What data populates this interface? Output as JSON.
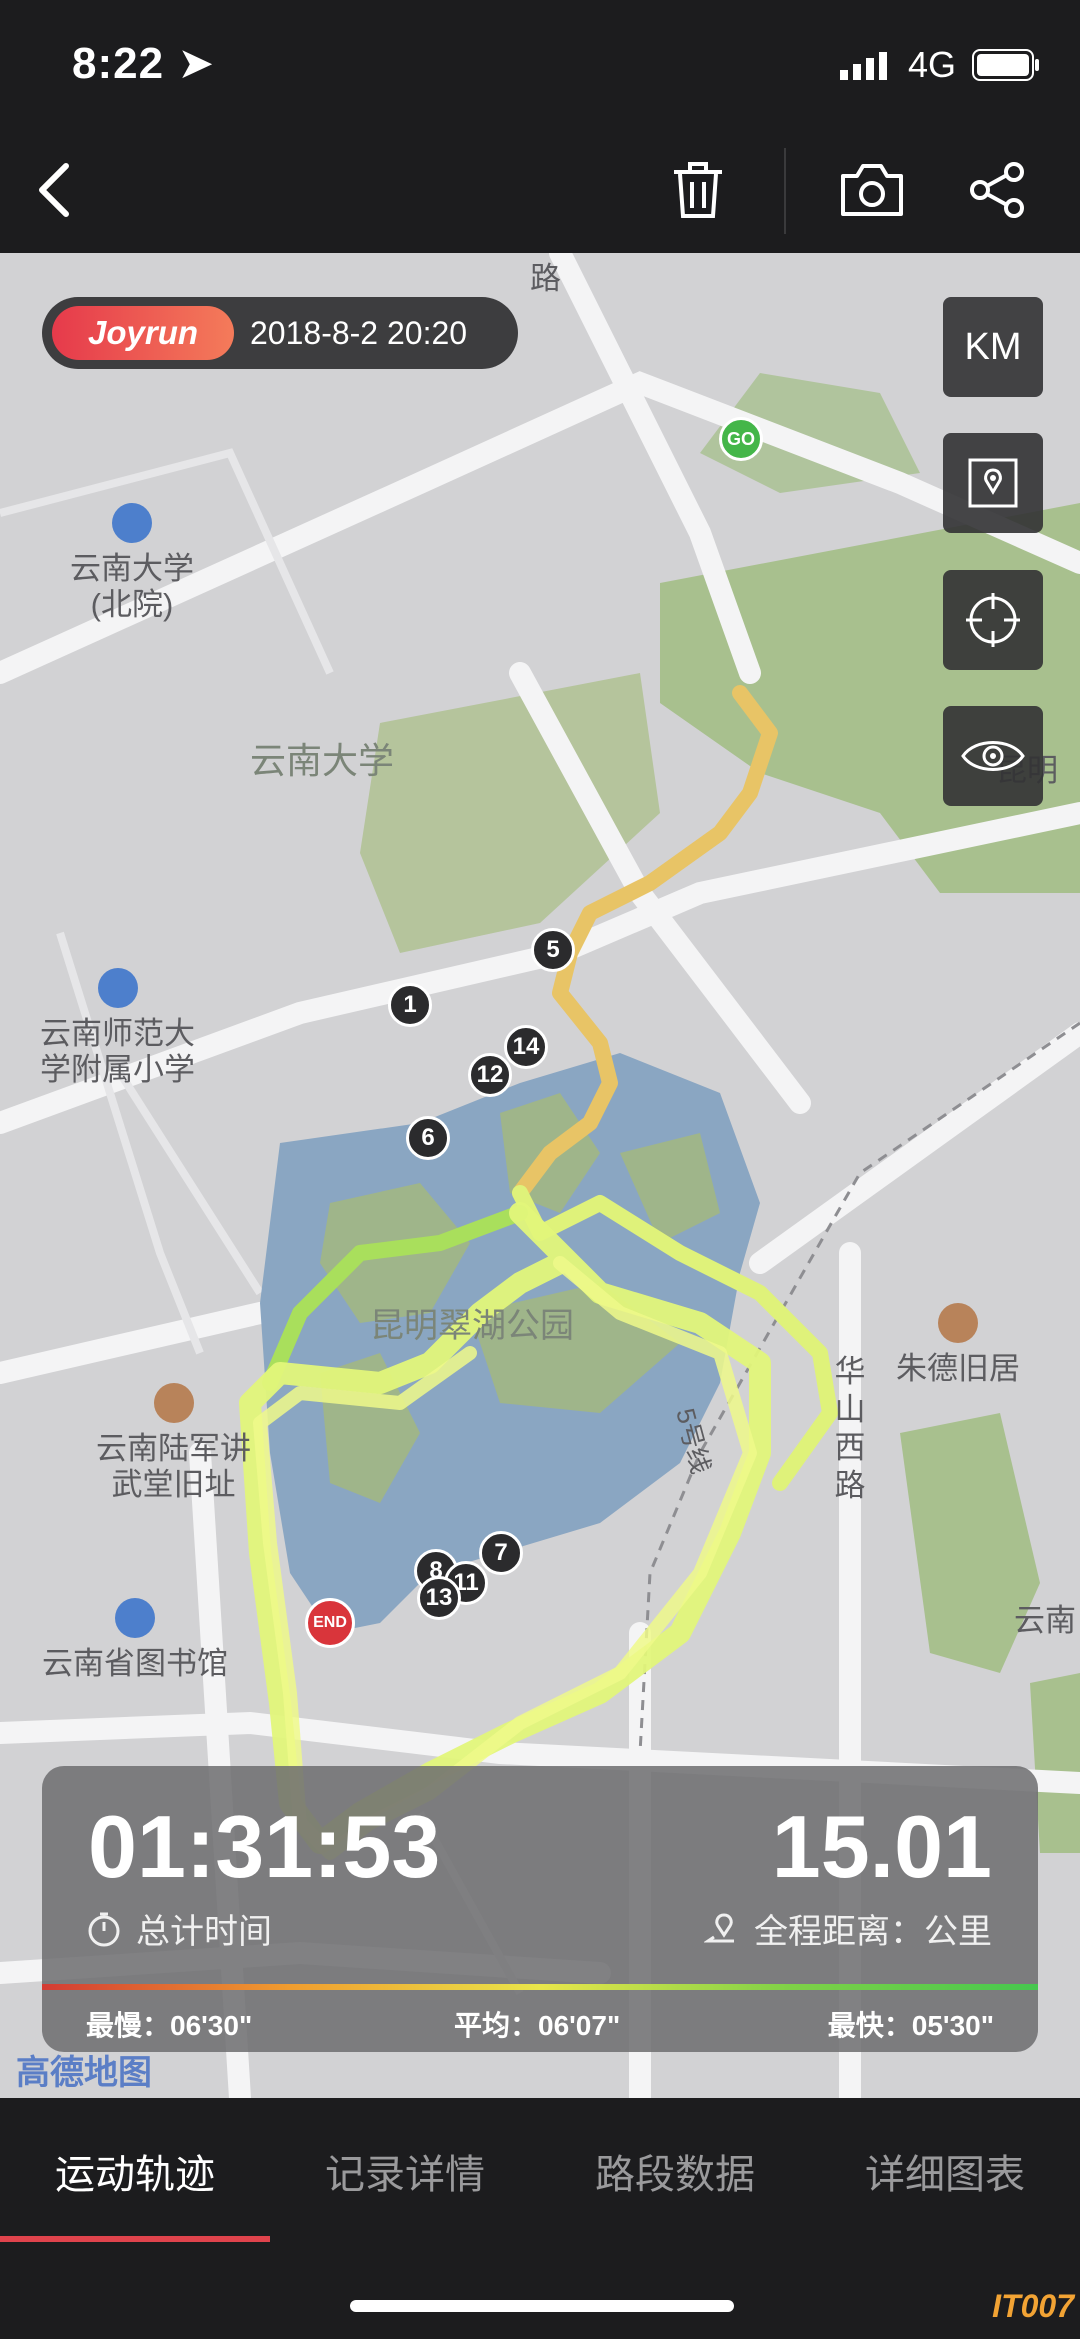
{
  "status": {
    "time": "8:22",
    "network": "4G"
  },
  "toolbar": {
    "back_icon": "chevron-left-icon",
    "delete_icon": "trash-icon",
    "camera_icon": "camera-icon",
    "share_icon": "share-icon"
  },
  "map": {
    "badge": {
      "logo": "Joyrun",
      "datetime": "2018-8-2 20:20"
    },
    "controls": {
      "unit": "KM",
      "layers_icon": "map-pin-icon",
      "locate_icon": "crosshair-icon",
      "visibility_icon": "eye-icon"
    },
    "labels": {
      "yunnan_univ_north": "云南大学\n(北院)",
      "yunnan_univ": "云南大学",
      "normal_school": "云南师范大\n学附属小学",
      "park": "昆明翠湖公园",
      "military_school": "云南陆军讲\n武堂旧址",
      "library": "云南省图书馆",
      "zhude": "朱德旧居",
      "huashan_road": "华\n山\n西\n路",
      "line5": "5号线",
      "kunming": "昆明",
      "yunnan_right": "云南",
      "road_top": "路"
    },
    "markers": {
      "go": "GO",
      "end": "END",
      "km": [
        "1",
        "5",
        "6",
        "7",
        "8",
        "11",
        "12",
        "13",
        "14"
      ]
    },
    "attribution": "高德地图"
  },
  "stats": {
    "duration": "01:31:53",
    "duration_label": "总计时间",
    "distance": "15.01",
    "distance_label": "全程距离：公里",
    "slowest": "最慢：06'30\"",
    "average": "平均：06'07\"",
    "fastest": "最快：05'30\""
  },
  "tabs": [
    {
      "label": "运动轨迹",
      "active": true
    },
    {
      "label": "记录详情",
      "active": false
    },
    {
      "label": "路段数据",
      "active": false
    },
    {
      "label": "详细图表",
      "active": false
    }
  ],
  "watermark": "IT007"
}
